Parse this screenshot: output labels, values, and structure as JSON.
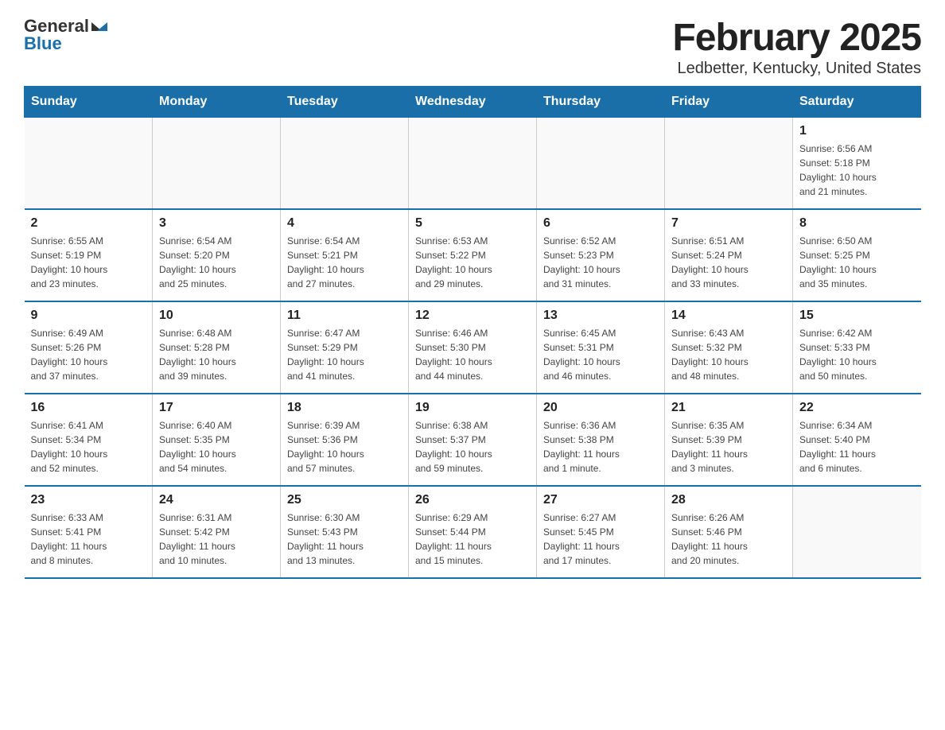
{
  "logo": {
    "general": "General",
    "blue": "Blue"
  },
  "title": "February 2025",
  "subtitle": "Ledbetter, Kentucky, United States",
  "weekdays": [
    "Sunday",
    "Monday",
    "Tuesday",
    "Wednesday",
    "Thursday",
    "Friday",
    "Saturday"
  ],
  "weeks": [
    [
      {
        "day": "",
        "info": ""
      },
      {
        "day": "",
        "info": ""
      },
      {
        "day": "",
        "info": ""
      },
      {
        "day": "",
        "info": ""
      },
      {
        "day": "",
        "info": ""
      },
      {
        "day": "",
        "info": ""
      },
      {
        "day": "1",
        "info": "Sunrise: 6:56 AM\nSunset: 5:18 PM\nDaylight: 10 hours\nand 21 minutes."
      }
    ],
    [
      {
        "day": "2",
        "info": "Sunrise: 6:55 AM\nSunset: 5:19 PM\nDaylight: 10 hours\nand 23 minutes."
      },
      {
        "day": "3",
        "info": "Sunrise: 6:54 AM\nSunset: 5:20 PM\nDaylight: 10 hours\nand 25 minutes."
      },
      {
        "day": "4",
        "info": "Sunrise: 6:54 AM\nSunset: 5:21 PM\nDaylight: 10 hours\nand 27 minutes."
      },
      {
        "day": "5",
        "info": "Sunrise: 6:53 AM\nSunset: 5:22 PM\nDaylight: 10 hours\nand 29 minutes."
      },
      {
        "day": "6",
        "info": "Sunrise: 6:52 AM\nSunset: 5:23 PM\nDaylight: 10 hours\nand 31 minutes."
      },
      {
        "day": "7",
        "info": "Sunrise: 6:51 AM\nSunset: 5:24 PM\nDaylight: 10 hours\nand 33 minutes."
      },
      {
        "day": "8",
        "info": "Sunrise: 6:50 AM\nSunset: 5:25 PM\nDaylight: 10 hours\nand 35 minutes."
      }
    ],
    [
      {
        "day": "9",
        "info": "Sunrise: 6:49 AM\nSunset: 5:26 PM\nDaylight: 10 hours\nand 37 minutes."
      },
      {
        "day": "10",
        "info": "Sunrise: 6:48 AM\nSunset: 5:28 PM\nDaylight: 10 hours\nand 39 minutes."
      },
      {
        "day": "11",
        "info": "Sunrise: 6:47 AM\nSunset: 5:29 PM\nDaylight: 10 hours\nand 41 minutes."
      },
      {
        "day": "12",
        "info": "Sunrise: 6:46 AM\nSunset: 5:30 PM\nDaylight: 10 hours\nand 44 minutes."
      },
      {
        "day": "13",
        "info": "Sunrise: 6:45 AM\nSunset: 5:31 PM\nDaylight: 10 hours\nand 46 minutes."
      },
      {
        "day": "14",
        "info": "Sunrise: 6:43 AM\nSunset: 5:32 PM\nDaylight: 10 hours\nand 48 minutes."
      },
      {
        "day": "15",
        "info": "Sunrise: 6:42 AM\nSunset: 5:33 PM\nDaylight: 10 hours\nand 50 minutes."
      }
    ],
    [
      {
        "day": "16",
        "info": "Sunrise: 6:41 AM\nSunset: 5:34 PM\nDaylight: 10 hours\nand 52 minutes."
      },
      {
        "day": "17",
        "info": "Sunrise: 6:40 AM\nSunset: 5:35 PM\nDaylight: 10 hours\nand 54 minutes."
      },
      {
        "day": "18",
        "info": "Sunrise: 6:39 AM\nSunset: 5:36 PM\nDaylight: 10 hours\nand 57 minutes."
      },
      {
        "day": "19",
        "info": "Sunrise: 6:38 AM\nSunset: 5:37 PM\nDaylight: 10 hours\nand 59 minutes."
      },
      {
        "day": "20",
        "info": "Sunrise: 6:36 AM\nSunset: 5:38 PM\nDaylight: 11 hours\nand 1 minute."
      },
      {
        "day": "21",
        "info": "Sunrise: 6:35 AM\nSunset: 5:39 PM\nDaylight: 11 hours\nand 3 minutes."
      },
      {
        "day": "22",
        "info": "Sunrise: 6:34 AM\nSunset: 5:40 PM\nDaylight: 11 hours\nand 6 minutes."
      }
    ],
    [
      {
        "day": "23",
        "info": "Sunrise: 6:33 AM\nSunset: 5:41 PM\nDaylight: 11 hours\nand 8 minutes."
      },
      {
        "day": "24",
        "info": "Sunrise: 6:31 AM\nSunset: 5:42 PM\nDaylight: 11 hours\nand 10 minutes."
      },
      {
        "day": "25",
        "info": "Sunrise: 6:30 AM\nSunset: 5:43 PM\nDaylight: 11 hours\nand 13 minutes."
      },
      {
        "day": "26",
        "info": "Sunrise: 6:29 AM\nSunset: 5:44 PM\nDaylight: 11 hours\nand 15 minutes."
      },
      {
        "day": "27",
        "info": "Sunrise: 6:27 AM\nSunset: 5:45 PM\nDaylight: 11 hours\nand 17 minutes."
      },
      {
        "day": "28",
        "info": "Sunrise: 6:26 AM\nSunset: 5:46 PM\nDaylight: 11 hours\nand 20 minutes."
      },
      {
        "day": "",
        "info": ""
      }
    ]
  ]
}
